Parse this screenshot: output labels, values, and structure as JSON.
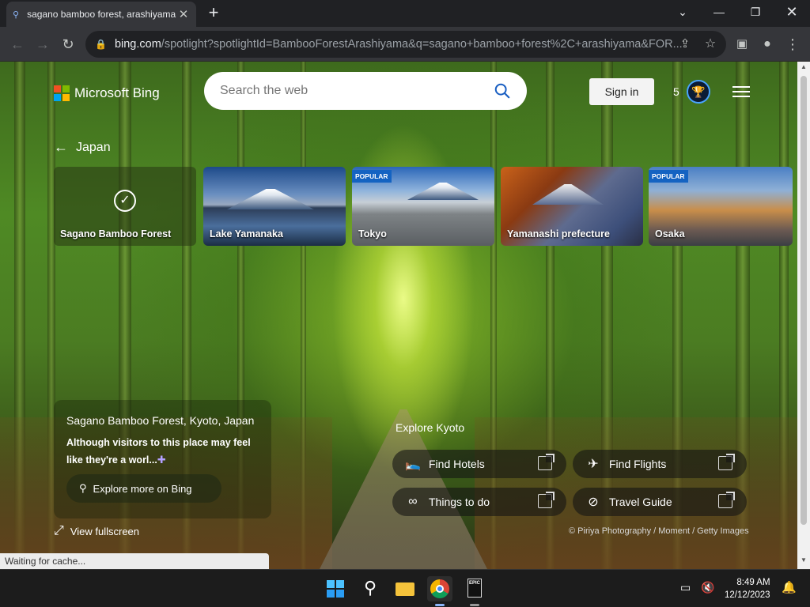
{
  "browser": {
    "tab_title": "sagano bamboo forest, arashiyama",
    "url_host": "bing.com",
    "url_path": "/spotlight?spotlightId=BambooForestArashiyama&q=sagano+bamboo+forest%2C+arashiyama&FOR..."
  },
  "header": {
    "logo_text": "Microsoft Bing",
    "search_placeholder": "Search the web",
    "sign_in": "Sign in",
    "points": "5"
  },
  "nav": {
    "back_label": "Japan"
  },
  "cards": [
    {
      "label": "Sagano Bamboo Forest",
      "badge": ""
    },
    {
      "label": "Lake Yamanaka",
      "badge": ""
    },
    {
      "label": "Tokyo",
      "badge": "POPULAR"
    },
    {
      "label": "Yamanashi prefecture",
      "badge": ""
    },
    {
      "label": "Osaka",
      "badge": "POPULAR"
    }
  ],
  "info": {
    "title": "Sagano Bamboo Forest, Kyoto, Japan",
    "desc": "Although visitors to this place may feel like they're a worl...",
    "explore": "Explore more on Bing",
    "fullscreen": "View fullscreen"
  },
  "kyoto": {
    "heading": "Explore Kyoto",
    "buttons": [
      "Find Hotels",
      "Find Flights",
      "Things to do",
      "Travel Guide"
    ]
  },
  "credit": "© Piriya Photography / Moment / Getty Images",
  "status": "Waiting for cache...",
  "taskbar": {
    "time": "8:49 AM",
    "date": "12/12/2023"
  },
  "colors": {
    "accent": "#1463c2",
    "page_bg": "#4f8a24"
  }
}
